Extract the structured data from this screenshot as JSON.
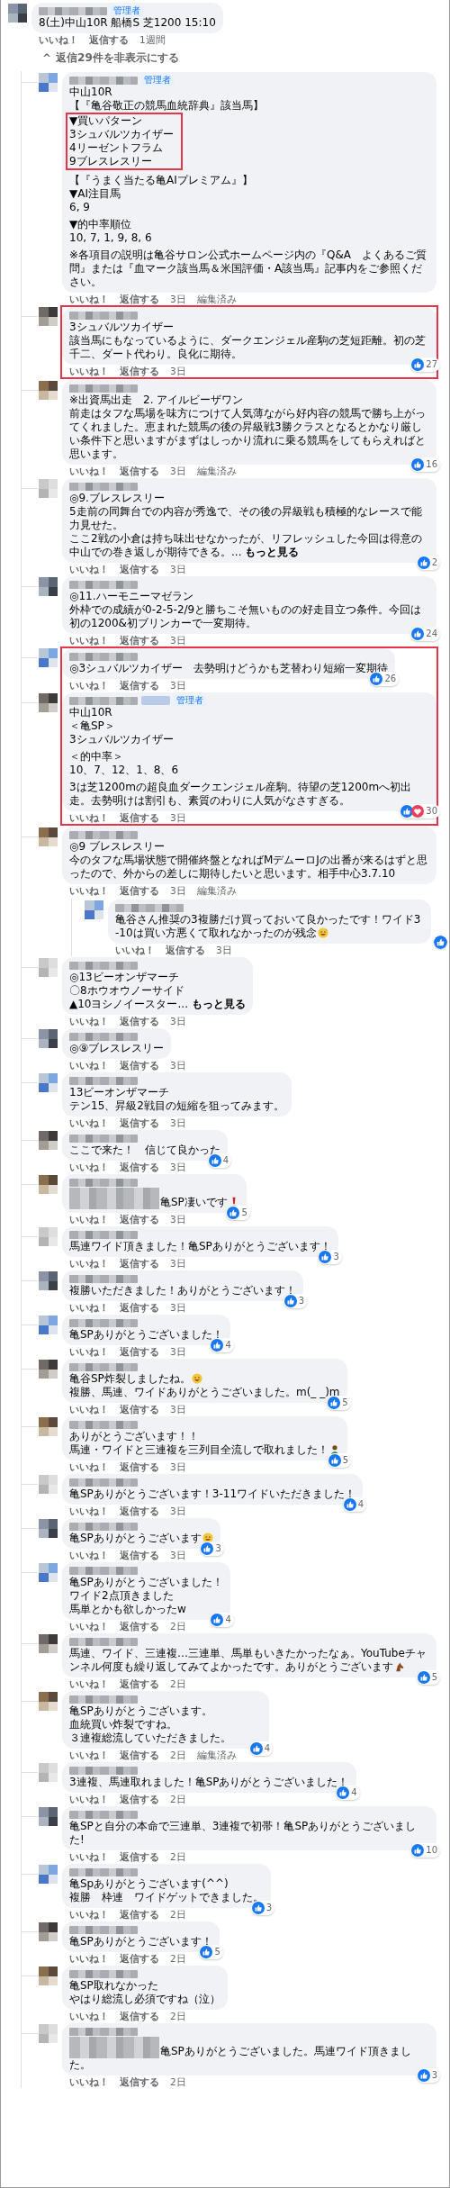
{
  "post": {
    "badge": "管理者",
    "lines": [
      {
        "text": "8(土)中山10R 船橋S 芝1200 15:10"
      }
    ],
    "like_label": "いいね！",
    "reply_label": "返信する",
    "time": "1週間"
  },
  "toggle": {
    "icon": "^",
    "label": "返信29件を非表示にする"
  },
  "replies": [
    {
      "highlighted": false,
      "badge": "管理者",
      "lines": [
        {
          "text": "中山10R"
        },
        {
          "text": "【『亀谷敬正の競馬血統辞典』該当馬】"
        },
        {
          "text": "▼買いパターン",
          "highlighted": true
        },
        {
          "text": "3シュバルツカイザー",
          "highlighted": true
        },
        {
          "text": "4リーゼントフラム",
          "highlighted": true
        },
        {
          "text": "9ブレスレスリー",
          "highlighted": true
        },
        {
          "text": "【『うまく当たる亀AIプレミアム』】",
          "space_before": true
        },
        {
          "text": "▼AI注目馬"
        },
        {
          "text": "6, 9"
        },
        {
          "text": "▼的中率順位",
          "space_before": true
        },
        {
          "text": "10, 7, 1, 9, 8, 6"
        },
        {
          "text": "※各項目の説明は亀谷サロン公式ホームページ内の『Q&A　よくあるご質問』または『血マーク該当馬＆米国評価・A該当馬』記事内をご参照ください。",
          "space_before": true
        }
      ],
      "like_label": "いいね！",
      "reply_label": "返信する",
      "time": "3日",
      "edited": "編集済み"
    },
    {
      "highlighted": true,
      "lines": [
        {
          "text": "3シュバルツカイザー"
        },
        {
          "text": "該当馬にもなっているように、ダークエンジェル産駒の芝短距離。初の芝千二、ダート代わり。良化に期待。"
        }
      ],
      "reaction": {
        "icons": [
          {
            "kind": "like"
          }
        ],
        "count": "27"
      },
      "like_label": "いいね！",
      "reply_label": "返信する",
      "time": "3日"
    },
    {
      "highlighted": false,
      "lines": [
        {
          "text": "※出資馬出走　2. アイルビーザワン"
        },
        {
          "text": "前走はタフな馬場を味方につけて人気薄ながら好内容の競馬で勝ち上がってくれました。恵まれた競馬の後の昇級戦3勝クラスとなるとかなり厳しい条件下と思いますがまずはしっかり流れに乗る競馬をしてもらえればと思います。"
        }
      ],
      "reaction": {
        "icons": [
          {
            "kind": "like"
          }
        ],
        "count": "16"
      },
      "like_label": "いいね！",
      "reply_label": "返信する",
      "time": "3日",
      "edited": "編集済み"
    },
    {
      "highlighted": false,
      "lines": [
        {
          "text": "◎9.ブレスレスリー"
        },
        {
          "text": "5走前の同舞台での内容が秀逸で、その後の昇級戦も積極的なレースで能力見せた。"
        },
        {
          "text": "ここ2戦の小倉は持ち味出せなかったが、リフレッシュした今回は得意の中山での巻き返しが期待できる。...",
          "more": "もっと見る"
        }
      ],
      "reaction": {
        "icons": [
          {
            "kind": "like"
          }
        ],
        "count": "2"
      },
      "like_label": "いいね！",
      "reply_label": "返信する",
      "time": "3日"
    },
    {
      "highlighted": false,
      "lines": [
        {
          "text": "◎11.ハーモニーマゼラン"
        },
        {
          "text": "外枠での成績が0-2-5-2/9と勝ちこそ無いものの好走目立つ条件。今回は初の1200&初ブリンカーで一変期待。"
        }
      ],
      "reaction": {
        "icons": [
          {
            "kind": "like"
          }
        ],
        "count": "24"
      },
      "like_label": "いいね！",
      "reply_label": "返信する",
      "time": "3日"
    },
    {
      "highlighted": true,
      "lines": [
        {
          "text": "◎3シュバルツカイザー　去勢明けどうかも芝替わり短縮一変期待"
        }
      ],
      "reaction": {
        "icons": [
          {
            "kind": "like"
          }
        ],
        "count": "26"
      },
      "like_label": "いいね！",
      "reply_label": "返信する",
      "time": "3日"
    },
    {
      "highlighted": true,
      "tag_blurred": true,
      "badge": "管理者",
      "lines": [
        {
          "text": "中山10R"
        },
        {
          "text": "＜亀SP＞"
        },
        {
          "text": "3シュバルツカイザー"
        },
        {
          "text": "＜的中率＞",
          "space_before": true
        },
        {
          "text": "10、7、12、1、8、6"
        },
        {
          "text": "3は芝1200mの超良血ダークエンジェル産駒。待望の芝1200mへ初出走。去勢明けは割引も、素質のわりに人気がなさすぎる。",
          "space_before": true
        }
      ],
      "reaction": {
        "icons": [
          {
            "kind": "like"
          },
          {
            "kind": "love"
          }
        ],
        "count": "30"
      },
      "like_label": "いいね！",
      "reply_label": "返信する",
      "time": "3日"
    },
    {
      "highlighted": false,
      "lines": [
        {
          "text": "◎9 ブレスレスリー"
        },
        {
          "text": "今のタフな馬場状態で開催終盤となればMデムーロJの出番が来るはずと思ったので、外からの差しに期待したいと思います。相手中心3.7.10"
        }
      ],
      "like_label": "いいね！",
      "reply_label": "返信する",
      "time": "3日",
      "edited": "編集済み",
      "replies": [
        {
          "lines": [
            {
              "text": "亀谷さん推奨の3複勝だけ買っておいて良かったです！ワイド3-10は買い方悪くて取れなかったのが残念",
              "emoji": {
                "kind": "sweat-smile"
              }
            }
          ],
          "reaction": {
            "icons": [
              {
                "kind": "like"
              }
            ]
          },
          "like_label": "いいね！",
          "reply_label": "返信する",
          "time": "3日"
        }
      ]
    },
    {
      "highlighted": false,
      "lines": [
        {
          "text": "◎13ビーオンザマーチ"
        },
        {
          "text": "〇8ホウオウノーサイド"
        },
        {
          "text": "▲10ヨシノイースター...",
          "more": "もっと見る"
        }
      ],
      "like_label": "いいね！",
      "reply_label": "返信する",
      "time": "3日"
    },
    {
      "highlighted": false,
      "lines": [
        {
          "text": "◎⑨ブレスレスリー"
        }
      ],
      "like_label": "いいね！",
      "reply_label": "返信する",
      "time": "3日"
    },
    {
      "highlighted": false,
      "lines": [
        {
          "text": "13ビーオンザマーチ"
        },
        {
          "text": "テン15、昇級2戦目の短縮を狙ってみます。"
        }
      ],
      "like_label": "いいね！",
      "reply_label": "返信する",
      "time": "3日"
    },
    {
      "highlighted": false,
      "lines": [
        {
          "text": "ここで来た！　信じて良かった"
        }
      ],
      "reaction": {
        "icons": [
          {
            "kind": "like"
          }
        ],
        "count": "4"
      },
      "like_label": "いいね！",
      "reply_label": "返信する",
      "time": "3日"
    },
    {
      "highlighted": false,
      "mention_blurred": true,
      "lines": [
        {
          "text": "亀SP凄いです",
          "emoji": {
            "kind": "exclamation"
          }
        }
      ],
      "reaction": {
        "icons": [
          {
            "kind": "like"
          }
        ],
        "count": "5"
      },
      "like_label": "いいね！",
      "reply_label": "返信する",
      "time": "3日"
    },
    {
      "highlighted": false,
      "lines": [
        {
          "text": "馬連ワイド頂きました！亀SPありがとうございます！"
        }
      ],
      "reaction": {
        "icons": [
          {
            "kind": "like"
          }
        ],
        "count": "3"
      },
      "like_label": "いいね！",
      "reply_label": "返信する",
      "time": "3日"
    },
    {
      "highlighted": false,
      "lines": [
        {
          "text": "複勝いただきました！ありがとうございます！"
        }
      ],
      "reaction": {
        "icons": [
          {
            "kind": "like"
          }
        ],
        "count": "3"
      },
      "like_label": "いいね！",
      "reply_label": "返信する",
      "time": "3日"
    },
    {
      "highlighted": false,
      "lines": [
        {
          "text": "亀SPありがとうございました！"
        }
      ],
      "reaction": {
        "icons": [
          {
            "kind": "like"
          }
        ],
        "count": "4"
      },
      "like_label": "いいね！",
      "reply_label": "返信する",
      "time": "3日"
    },
    {
      "highlighted": false,
      "lines": [
        {
          "text": "亀谷SP炸裂しましたね。",
          "emoji": {
            "kind": "grin"
          }
        },
        {
          "text": "複勝、馬連、ワイドありがとうございました。m(_ _)m"
        }
      ],
      "reaction": {
        "icons": [
          {
            "kind": "like"
          }
        ],
        "count": "5"
      },
      "like_label": "いいね！",
      "reply_label": "返信する",
      "time": "3日"
    },
    {
      "highlighted": false,
      "lines": [
        {
          "text": "ありがとうございます！！"
        },
        {
          "text": "馬連・ワイドと三連複を三列目全流しで取れました！",
          "emoji": {
            "kind": "bow"
          }
        }
      ],
      "reaction": {
        "icons": [
          {
            "kind": "like"
          }
        ],
        "count": "5"
      },
      "like_label": "いいね！",
      "reply_label": "返信する",
      "time": "3日"
    },
    {
      "highlighted": false,
      "lines": [
        {
          "text": "亀SPありがとうございます！3-11ワイドいただきました！"
        }
      ],
      "reaction": {
        "icons": [
          {
            "kind": "like"
          }
        ],
        "count": "4"
      },
      "like_label": "いいね！",
      "reply_label": "返信する",
      "time": "3日"
    },
    {
      "highlighted": false,
      "lines": [
        {
          "text": "亀SPありがとうございます",
          "emoji": {
            "kind": "smile"
          }
        }
      ],
      "reaction": {
        "icons": [
          {
            "kind": "like"
          }
        ],
        "count": "3"
      },
      "like_label": "いいね！",
      "reply_label": "返信する",
      "time": "3日"
    },
    {
      "highlighted": false,
      "lines": [
        {
          "text": "亀SPありがとうございました！"
        },
        {
          "text": "ワイド2点頂きました"
        },
        {
          "text": "馬単とかも欲しかったw"
        }
      ],
      "reaction": {
        "icons": [
          {
            "kind": "like"
          }
        ],
        "count": "4"
      },
      "like_label": "いいね！",
      "reply_label": "返信する",
      "time": "2日"
    },
    {
      "highlighted": false,
      "lines": [
        {
          "text": "馬連、ワイド、三連複…三連単、馬単もいきたかったなぁ。YouTubeチャンネル何度も繰り返してみてよかったです。ありがとうございます",
          "emoji": {
            "kind": "horse"
          }
        }
      ],
      "reaction": {
        "icons": [
          {
            "kind": "like"
          }
        ],
        "count": "5"
      },
      "like_label": "いいね！",
      "reply_label": "返信する",
      "time": "2日"
    },
    {
      "highlighted": false,
      "lines": [
        {
          "text": "亀SPありがとうございます。"
        },
        {
          "text": "血統買い炸裂ですね。"
        },
        {
          "text": "３連複総流していただきました。"
        }
      ],
      "reaction": {
        "icons": [
          {
            "kind": "like"
          }
        ],
        "count": "4"
      },
      "like_label": "いいね！",
      "reply_label": "返信する",
      "time": "2日",
      "edited": "編集済み"
    },
    {
      "highlighted": false,
      "lines": [
        {
          "text": "3連複、馬連取れました！亀SPありがとうございました！"
        }
      ],
      "reaction": {
        "icons": [
          {
            "kind": "like"
          }
        ],
        "count": "4"
      },
      "like_label": "いいね！",
      "reply_label": "返信する",
      "time": "2日"
    },
    {
      "highlighted": false,
      "lines": [
        {
          "text": "亀SPと自分の本命で三連単、3連複で初帯！亀SPありがとうございました!"
        }
      ],
      "reaction": {
        "icons": [
          {
            "kind": "like"
          }
        ],
        "count": "10"
      },
      "like_label": "いいね！",
      "reply_label": "返信する",
      "time": "2日"
    },
    {
      "highlighted": false,
      "lines": [
        {
          "text": "亀Spありがとうございます(^^)"
        },
        {
          "text": "複勝　枠連　ワイドゲットできました。"
        }
      ],
      "reaction": {
        "icons": [
          {
            "kind": "like"
          }
        ],
        "count": "3"
      },
      "like_label": "いいね！",
      "reply_label": "返信する",
      "time": "2日"
    },
    {
      "highlighted": false,
      "lines": [
        {
          "text": "亀SPありがとうございます！"
        }
      ],
      "reaction": {
        "icons": [
          {
            "kind": "like"
          }
        ],
        "count": "5"
      },
      "like_label": "いいね！",
      "reply_label": "返信する",
      "time": "2日"
    },
    {
      "highlighted": false,
      "lines": [
        {
          "text": "亀SP取れなかった"
        },
        {
          "text": "やはり総流し必須ですね（泣）"
        }
      ],
      "like_label": "いいね！",
      "reply_label": "返信する",
      "time": "2日"
    },
    {
      "highlighted": false,
      "mention_blurred": true,
      "lines": [
        {
          "text": "亀SPありがとうございました。馬連ワイド頂きました。"
        }
      ],
      "reaction": {
        "icons": [
          {
            "kind": "like"
          }
        ],
        "count": "3"
      },
      "like_label": "いいね！",
      "reply_label": "返信する",
      "time": "2日"
    }
  ]
}
